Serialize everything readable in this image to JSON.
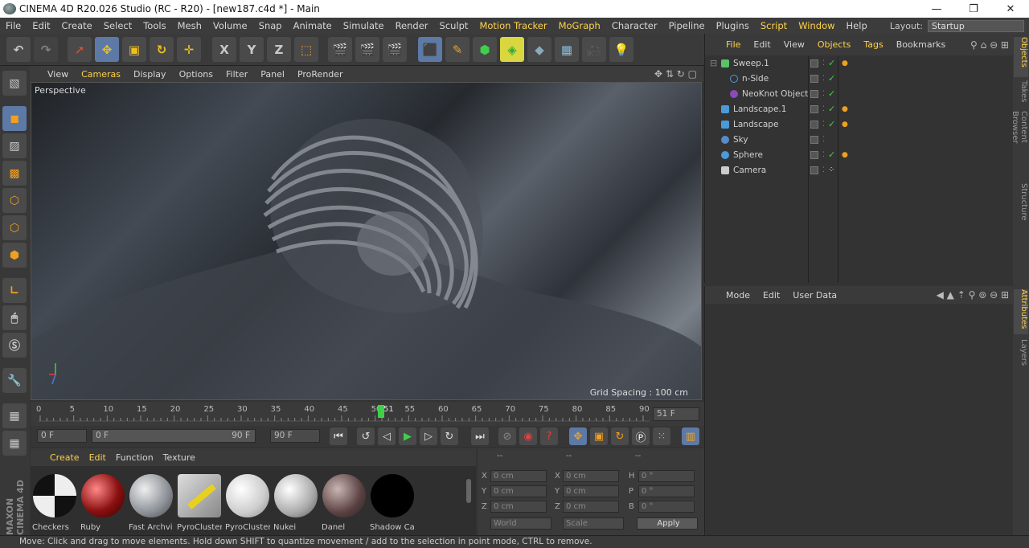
{
  "window": {
    "title": "CINEMA 4D R20.026 Studio (RC - R20) - [new187.c4d *] - Main"
  },
  "menu": {
    "items": [
      "File",
      "Edit",
      "Create",
      "Select",
      "Tools",
      "Mesh",
      "Volume",
      "Snap",
      "Animate",
      "Simulate",
      "Render",
      "Sculpt",
      "Motion Tracker",
      "MoGraph",
      "Character",
      "Pipeline",
      "Plugins",
      "Script",
      "Window",
      "Help"
    ],
    "layout_label": "Layout:",
    "layout_value": "Startup"
  },
  "toolbar": {
    "x_label": "X",
    "y_label": "Y",
    "z_label": "Z"
  },
  "viewport": {
    "menu": [
      "View",
      "Cameras",
      "Display",
      "Options",
      "Filter",
      "Panel",
      "ProRender"
    ],
    "label": "Perspective",
    "grid_spacing": "Grid Spacing : 100 cm"
  },
  "timeline": {
    "ticks": [
      "0",
      "5",
      "10",
      "15",
      "20",
      "25",
      "30",
      "35",
      "40",
      "45",
      "50",
      "51",
      "55",
      "60",
      "65",
      "70",
      "75",
      "80",
      "85",
      "90"
    ],
    "current_frame": "51 F",
    "start_field": "0 F",
    "range_start": "0 F",
    "range_end": "90 F",
    "end_field": "90 F"
  },
  "materials": {
    "menu": [
      "Create",
      "Edit",
      "Function",
      "Texture"
    ],
    "items": [
      {
        "name": "Checkers"
      },
      {
        "name": "Ruby"
      },
      {
        "name": "Fast Archvi"
      },
      {
        "name": "PyroCluster"
      },
      {
        "name": "PyroCluster"
      },
      {
        "name": "Nukei"
      },
      {
        "name": "Danel"
      },
      {
        "name": "Shadow Ca"
      }
    ]
  },
  "coords": {
    "headers": [
      "--",
      "--",
      "--"
    ],
    "pos": {
      "x": "0 cm",
      "y": "0 cm",
      "z": "0 cm"
    },
    "size": {
      "x": "0 cm",
      "y": "0 cm",
      "z": "0 cm"
    },
    "rot": {
      "h": "0 °",
      "p": "0 °",
      "b": "0 °"
    },
    "labels": {
      "x": "X",
      "y": "Y",
      "z": "Z",
      "h": "H",
      "p": "P",
      "b": "B"
    },
    "world": "World",
    "scale": "Scale",
    "apply": "Apply"
  },
  "objects": {
    "menu": [
      "File",
      "Edit",
      "View",
      "Objects",
      "Tags",
      "Bookmarks"
    ],
    "items": [
      {
        "name": "Sweep.1",
        "color": "#59c26a"
      },
      {
        "name": "n-Side",
        "color": "#4a9ad8"
      },
      {
        "name": "NeoKnot Object",
        "color": "#8a4ab8"
      },
      {
        "name": "Landscape.1",
        "color": "#4a9ad8"
      },
      {
        "name": "Landscape",
        "color": "#4a9ad8"
      },
      {
        "name": "Sky",
        "color": "#5a8ac8"
      },
      {
        "name": "Sphere",
        "color": "#4a9ad8"
      },
      {
        "name": "Camera",
        "color": "#cccccc"
      }
    ]
  },
  "attributes": {
    "menu": [
      "Mode",
      "Edit",
      "User Data"
    ]
  },
  "side_tabs": [
    "Objects",
    "Takes",
    "Content Browser",
    "Structure",
    "Attributes",
    "Layers"
  ],
  "brand": "MAXON CINEMA 4D",
  "status": "Move: Click and drag to move elements. Hold down SHIFT to quantize movement / add to the selection in point mode, CTRL to remove."
}
